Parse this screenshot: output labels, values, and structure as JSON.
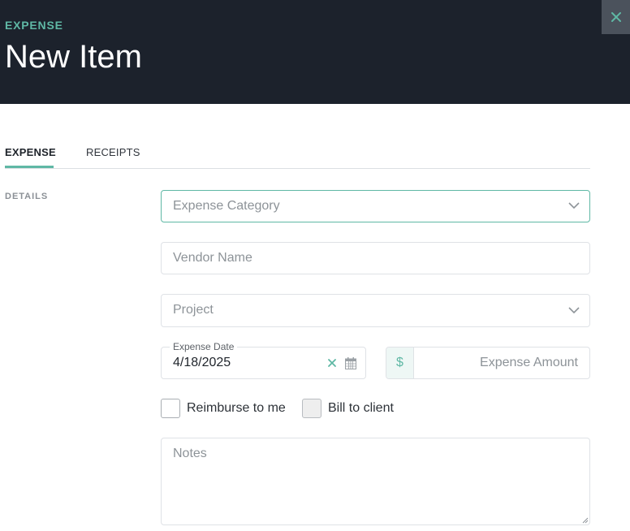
{
  "header": {
    "eyebrow": "EXPENSE",
    "title": "New Item",
    "close_icon": "close-icon"
  },
  "tabs": [
    {
      "label": "EXPENSE",
      "active": true
    },
    {
      "label": "RECEIPTS",
      "active": false
    }
  ],
  "section": {
    "label": "DETAILS"
  },
  "form": {
    "category": {
      "placeholder": "Expense Category",
      "icon": "chevron-down-icon"
    },
    "vendor": {
      "placeholder": "Vendor Name"
    },
    "project": {
      "placeholder": "Project",
      "icon": "chevron-down-icon"
    },
    "date": {
      "label": "Expense Date",
      "value": "4/18/2025",
      "clear_icon": "clear-x-icon",
      "calendar_icon": "calendar-icon"
    },
    "amount": {
      "currency": "$",
      "placeholder": "Expense Amount"
    },
    "reimburse": {
      "label": "Reimburse to me",
      "checked": false
    },
    "bill": {
      "label": "Bill to client",
      "checked": false
    },
    "notes": {
      "placeholder": "Notes"
    }
  },
  "colors": {
    "header_bg": "#1c222c",
    "accent": "#5fb8a5",
    "close_bg": "#4b525c",
    "border": "#dfe2e6"
  }
}
